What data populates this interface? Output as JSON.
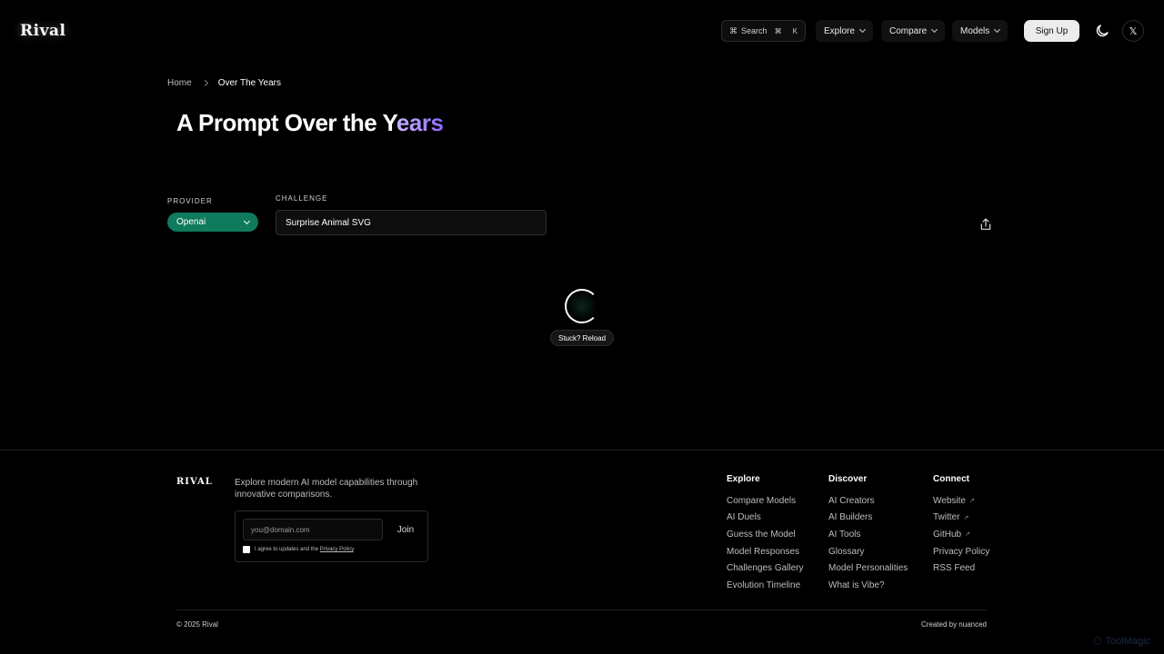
{
  "header": {
    "logo": "Rival",
    "search": {
      "label": "Search",
      "shortcut_mod": "⌘",
      "shortcut_key": "K"
    },
    "nav": [
      {
        "label": "Explore"
      },
      {
        "label": "Compare"
      },
      {
        "label": "Models"
      }
    ],
    "signup_label": "Sign Up",
    "x_label": "𝕏"
  },
  "breadcrumb": {
    "home": "Home",
    "current": "Over The Years"
  },
  "title": {
    "main": "A Prompt Over the Y",
    "accent": "ears"
  },
  "controls": {
    "provider_label": "PROVIDER",
    "provider_value": "Openai",
    "challenge_label": "CHALLENGE",
    "challenge_value": "Surprise Animal SVG"
  },
  "loader": {
    "reload_label": "Stuck? Reload"
  },
  "footer": {
    "logo": "RIVAL",
    "description": "Explore modern AI model capabilities through innovative comparisons.",
    "newsletter": {
      "placeholder": "you@domain.com",
      "join_label": "Join",
      "agree_text": "I agree to updates and the ",
      "privacy_link": "Privacy Policy",
      "agree_end": "."
    },
    "columns": {
      "explore": {
        "title": "Explore",
        "items": [
          "Compare Models",
          "AI Duels",
          "Guess the Model",
          "Model Responses",
          "Challenges Gallery",
          "Evolution Timeline"
        ]
      },
      "discover": {
        "title": "Discover",
        "items": [
          "AI Creators",
          "AI Builders",
          "AI Tools",
          "Glossary",
          "Model Personalities",
          "What is Vibe?"
        ]
      },
      "connect": {
        "title": "Connect",
        "items": [
          "Website",
          "Twitter",
          "GitHub",
          "Privacy Policy",
          "RSS Feed"
        ]
      }
    },
    "copyright": "© 2025 Rival",
    "created_by": "Created by nuanced"
  },
  "watermark": "ToolMagic",
  "colors": {
    "accent_green": "#0f7a5c",
    "accent_purple": "#a98bff"
  }
}
